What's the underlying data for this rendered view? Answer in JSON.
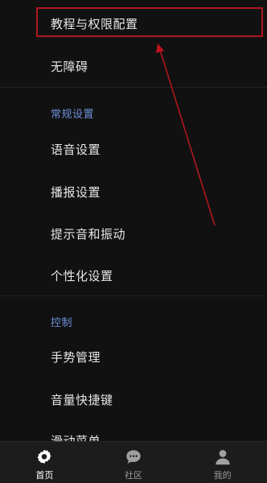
{
  "menu": {
    "top_items": [
      {
        "label": "教程与权限配置"
      },
      {
        "label": "无障碍"
      }
    ],
    "section_general": {
      "title": "常规设置",
      "items": [
        {
          "label": "语音设置"
        },
        {
          "label": "播报设置"
        },
        {
          "label": "提示音和振动"
        },
        {
          "label": "个性化设置"
        }
      ]
    },
    "section_control": {
      "title": "控制",
      "items": [
        {
          "label": "手势管理"
        },
        {
          "label": "音量快捷键"
        },
        {
          "label": "滑动菜单"
        }
      ]
    }
  },
  "tabbar": {
    "tabs": [
      {
        "label": "首页",
        "icon": "gear-icon"
      },
      {
        "label": "社区",
        "icon": "chat-bubble-icon"
      },
      {
        "label": "我的",
        "icon": "person-icon"
      }
    ]
  },
  "colors": {
    "background": "#111111",
    "section_title": "#6d8fd8",
    "annotation": "#b0171f",
    "tabbar": "#1c1c1c"
  }
}
